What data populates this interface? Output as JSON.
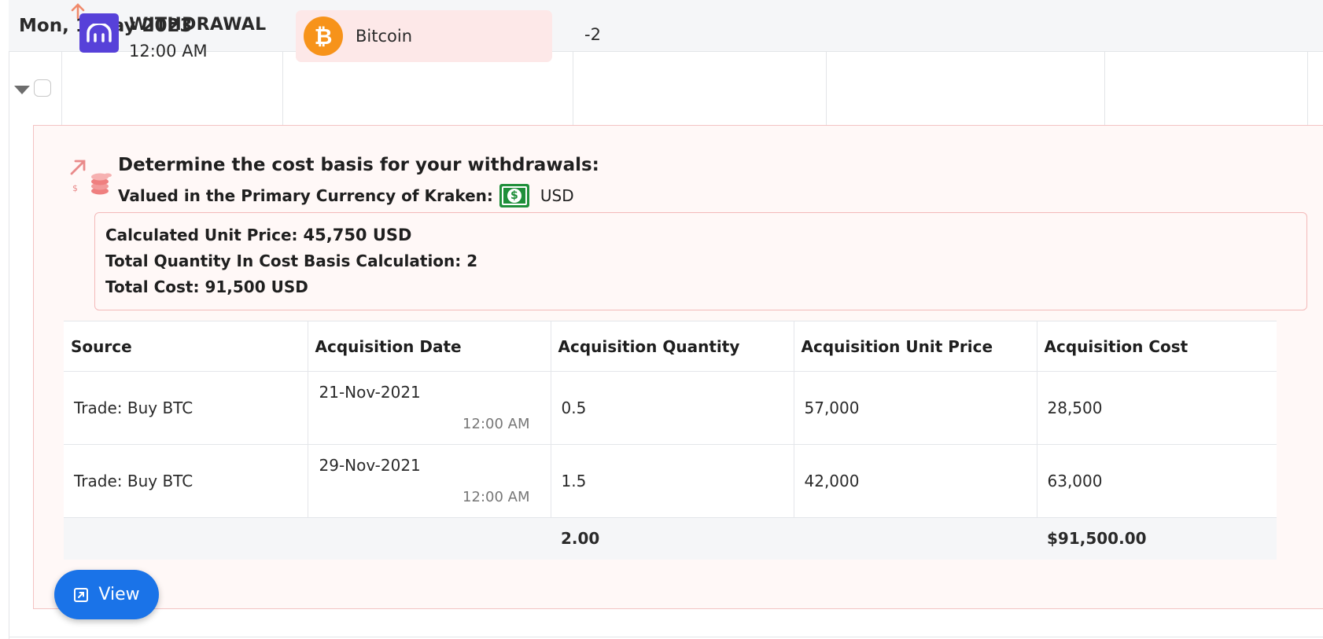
{
  "date_header": "Mon, 1 May 2023",
  "transaction": {
    "type": "WITHDRAWAL",
    "time": "12:00 AM",
    "exchange_icon": "kraken-logo-icon",
    "asset": {
      "name": "Bitcoin",
      "icon": "bitcoin-icon",
      "symbol_glyph": "₿"
    },
    "amount": "-2"
  },
  "detail": {
    "heading": "Determine the cost basis for your withdrawals:",
    "subheading": "Valued in the Primary Currency of Kraken:",
    "currency": "USD",
    "summary": {
      "unit_price_label": "Calculated Unit Price: ",
      "unit_price_value": "45,750 USD",
      "quantity_label": "Total Quantity In Cost Basis Calculation: ",
      "quantity_value": "2",
      "total_cost_label": "Total Cost: ",
      "total_cost_value": "91,500 USD"
    },
    "table": {
      "columns": [
        "Source",
        "Acquisition Date",
        "Acquisition Quantity",
        "Acquisition Unit Price",
        "Acquisition Cost"
      ],
      "rows": [
        {
          "source": "Trade: Buy BTC",
          "date": "21-Nov-2021",
          "time": "12:00 AM",
          "quantity": "0.5",
          "unit_price": "57,000",
          "cost": "28,500"
        },
        {
          "source": "Trade: Buy BTC",
          "date": "29-Nov-2021",
          "time": "12:00 AM",
          "quantity": "1.5",
          "unit_price": "42,000",
          "cost": "63,000"
        }
      ],
      "totals": {
        "quantity": "2.00",
        "cost": "$91,500.00"
      }
    },
    "view_button_label": "View"
  },
  "colors": {
    "kraken_purple": "#5741d9",
    "bitcoin_orange": "#f7931a",
    "panel_bg": "#fff8f7",
    "panel_border": "#f3c3c3",
    "button_blue": "#1a73e8",
    "cash_green": "#1f8f3a"
  }
}
